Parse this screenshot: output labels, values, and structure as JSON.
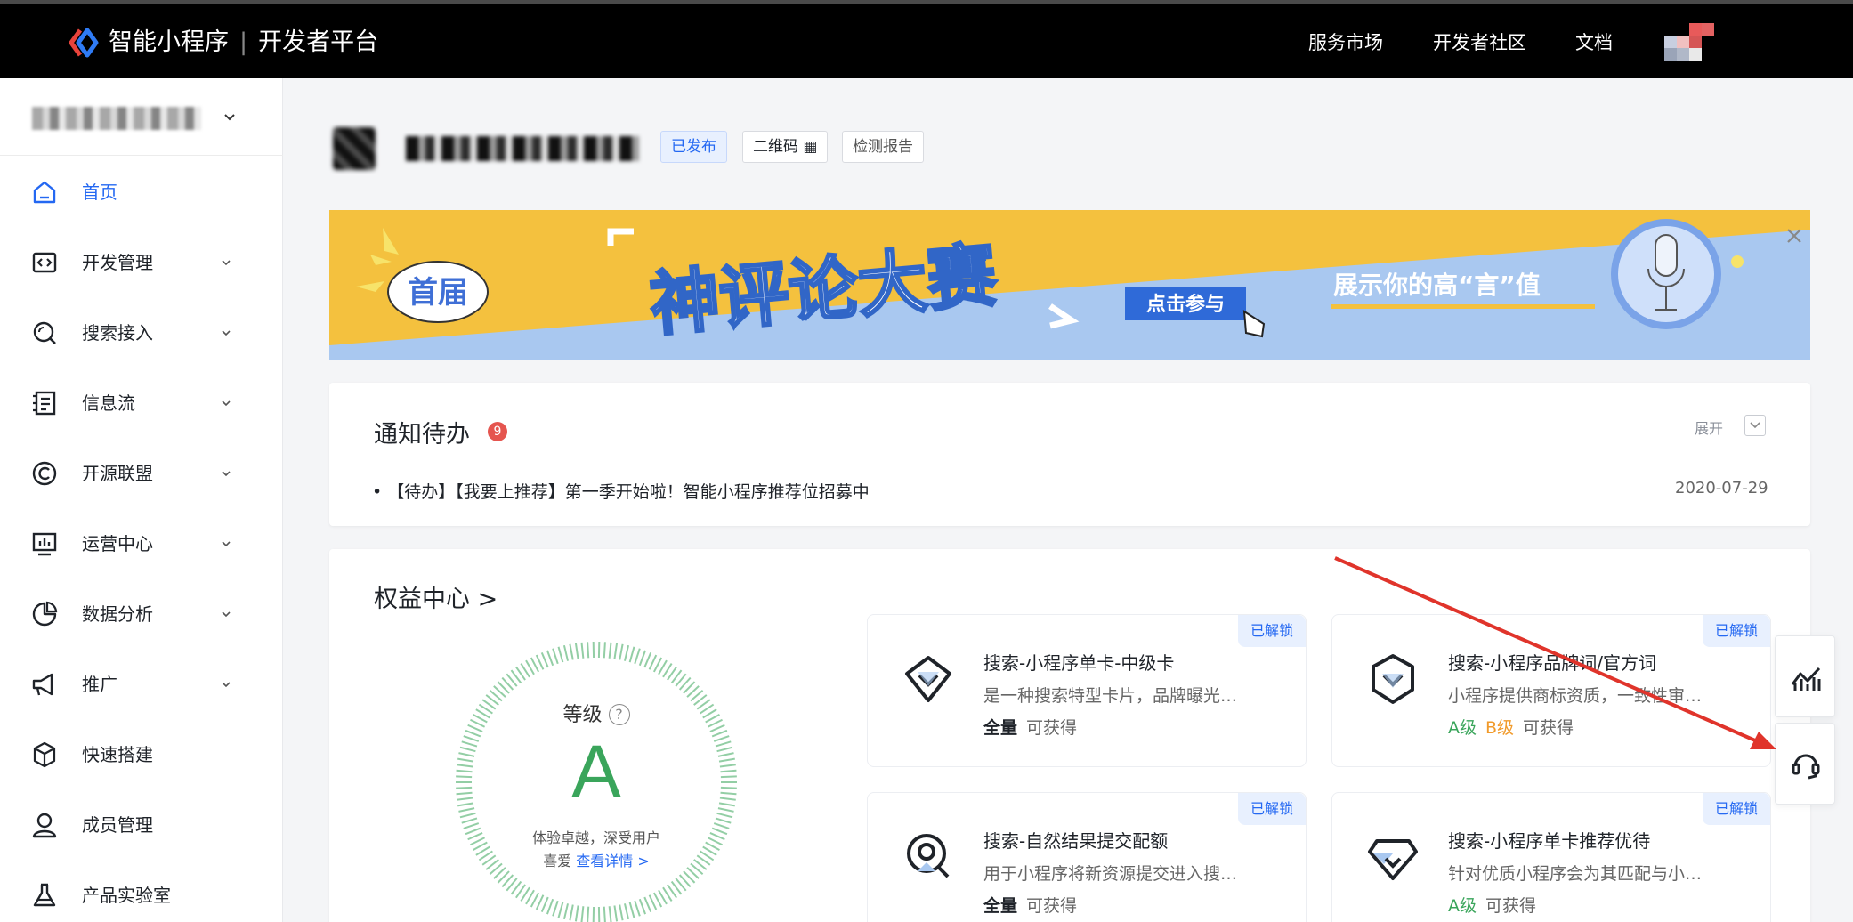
{
  "topbar": {
    "brand": "智能小程序",
    "separator": "|",
    "platform": "开发者平台",
    "nav": [
      "服务市场",
      "开发者社区",
      "文档"
    ]
  },
  "sidebar": {
    "items": [
      {
        "label": "首页",
        "icon": "home-icon",
        "expandable": false,
        "active": true
      },
      {
        "label": "开发管理",
        "icon": "code-icon",
        "expandable": true
      },
      {
        "label": "搜索接入",
        "icon": "search-icon",
        "expandable": true
      },
      {
        "label": "信息流",
        "icon": "feed-icon",
        "expandable": true
      },
      {
        "label": "开源联盟",
        "icon": "alliance-icon",
        "expandable": true
      },
      {
        "label": "运营中心",
        "icon": "monitor-icon",
        "expandable": true
      },
      {
        "label": "数据分析",
        "icon": "pie-chart-icon",
        "expandable": true
      },
      {
        "label": "推广",
        "icon": "megaphone-icon",
        "expandable": true
      },
      {
        "label": "快速搭建",
        "icon": "cube-icon",
        "expandable": false
      },
      {
        "label": "成员管理",
        "icon": "user-icon",
        "expandable": false
      },
      {
        "label": "产品实验室",
        "icon": "flask-icon",
        "expandable": false
      }
    ]
  },
  "app_header": {
    "tags": [
      "已发布",
      "二维码",
      "检测报告"
    ]
  },
  "banner": {
    "badge": "首届",
    "title": "神评论大赛",
    "cta": "点击参与",
    "slogan": "展示你的高“言”值"
  },
  "notice": {
    "title": "通知待办",
    "count": "9",
    "expand_label": "展开",
    "item": "【待办】【我要上推荐】第一季开始啦！智能小程序推荐位招募中",
    "date": "2020-07-29"
  },
  "rights": {
    "title": "权益中心 >",
    "grade_label": "等级",
    "grade_value": "A",
    "grade_desc_1": "体验卓越，深受用户",
    "grade_desc_2": "喜爱",
    "grade_link": "查看详情 >",
    "cards": [
      {
        "unlock": "已解锁",
        "title": "搜索-小程序单卡-中级卡",
        "desc": "是一种搜索特型卡片，品牌曝光…",
        "scope": "全量",
        "avail": "可获得",
        "icon": "diamond-card-icon"
      },
      {
        "unlock": "已解锁",
        "title": "搜索-小程序品牌词/官方词",
        "desc": "小程序提供商标资质，一致性审…",
        "grade_a": "A级",
        "grade_b": "B级",
        "avail": "可获得",
        "icon": "hexagon-brand-icon"
      },
      {
        "unlock": "已解锁",
        "title": "搜索-自然结果提交配额",
        "desc": "用于小程序将新资源提交进入搜…",
        "scope": "全量",
        "avail": "可获得",
        "icon": "search-quota-icon"
      },
      {
        "unlock": "已解锁",
        "title": "搜索-小程序单卡推荐优待",
        "desc": "针对优质小程序会为其匹配与小…",
        "grade_a": "A级",
        "avail": "可获得",
        "icon": "gem-icon"
      }
    ]
  },
  "colors": {
    "primary": "#2468f2",
    "grade_green": "#3aa55b",
    "badge_red": "#e5554f",
    "banner_yellow": "#f4c13e",
    "banner_blue": "#a9c8f0",
    "annotation_red": "#e0342b"
  }
}
